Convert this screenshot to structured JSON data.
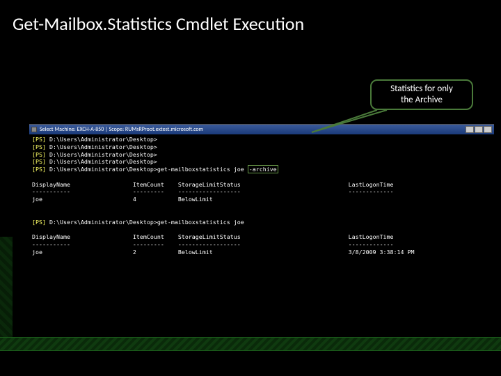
{
  "title": "Get-Mailbox.Statistics Cmdlet Execution",
  "callout": {
    "line1": "Statistics for only",
    "line2": "the Archive"
  },
  "titlebar": "Select Machine: EXCH-A-850 | Scope: RUMsRProot.extest.microsoft.com",
  "prompt": "D:\\Users\\Administrator\\Desktop>",
  "cmd1": "get-mailboxstatistics joe ",
  "cmd1_arg": "-archive",
  "columns": {
    "c1": "DisplayName",
    "c2": "ItemCount",
    "c3": "StorageLimitStatus",
    "c4": "LastLogonTime"
  },
  "dash": {
    "c1": "-----------",
    "c2": "---------",
    "c3": "------------------",
    "c4": "-------------"
  },
  "row1": {
    "name": "joe",
    "items": "4",
    "status": "BelowLimit",
    "logon": ""
  },
  "cmd2": "get-mailboxstatistics joe",
  "row2": {
    "name": "joe",
    "items": "2",
    "status": "BelowLimit",
    "logon": "3/8/2009 3:38:14 PM"
  },
  "ps": "[PS]"
}
